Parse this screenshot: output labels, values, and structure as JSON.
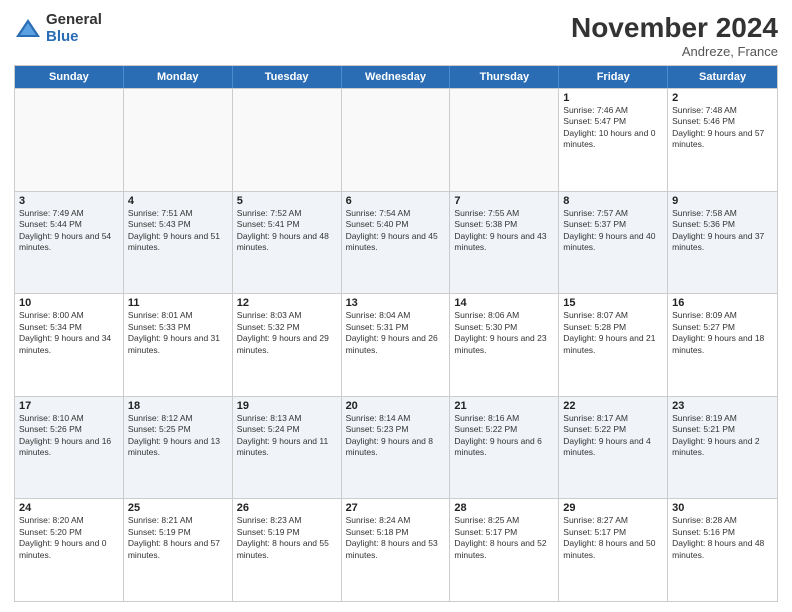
{
  "logo": {
    "general": "General",
    "blue": "Blue"
  },
  "title": "November 2024",
  "subtitle": "Andreze, France",
  "days": [
    "Sunday",
    "Monday",
    "Tuesday",
    "Wednesday",
    "Thursday",
    "Friday",
    "Saturday"
  ],
  "weeks": [
    [
      {
        "day": "",
        "info": ""
      },
      {
        "day": "",
        "info": ""
      },
      {
        "day": "",
        "info": ""
      },
      {
        "day": "",
        "info": ""
      },
      {
        "day": "",
        "info": ""
      },
      {
        "day": "1",
        "info": "Sunrise: 7:46 AM\nSunset: 5:47 PM\nDaylight: 10 hours and 0 minutes."
      },
      {
        "day": "2",
        "info": "Sunrise: 7:48 AM\nSunset: 5:46 PM\nDaylight: 9 hours and 57 minutes."
      }
    ],
    [
      {
        "day": "3",
        "info": "Sunrise: 7:49 AM\nSunset: 5:44 PM\nDaylight: 9 hours and 54 minutes."
      },
      {
        "day": "4",
        "info": "Sunrise: 7:51 AM\nSunset: 5:43 PM\nDaylight: 9 hours and 51 minutes."
      },
      {
        "day": "5",
        "info": "Sunrise: 7:52 AM\nSunset: 5:41 PM\nDaylight: 9 hours and 48 minutes."
      },
      {
        "day": "6",
        "info": "Sunrise: 7:54 AM\nSunset: 5:40 PM\nDaylight: 9 hours and 45 minutes."
      },
      {
        "day": "7",
        "info": "Sunrise: 7:55 AM\nSunset: 5:38 PM\nDaylight: 9 hours and 43 minutes."
      },
      {
        "day": "8",
        "info": "Sunrise: 7:57 AM\nSunset: 5:37 PM\nDaylight: 9 hours and 40 minutes."
      },
      {
        "day": "9",
        "info": "Sunrise: 7:58 AM\nSunset: 5:36 PM\nDaylight: 9 hours and 37 minutes."
      }
    ],
    [
      {
        "day": "10",
        "info": "Sunrise: 8:00 AM\nSunset: 5:34 PM\nDaylight: 9 hours and 34 minutes."
      },
      {
        "day": "11",
        "info": "Sunrise: 8:01 AM\nSunset: 5:33 PM\nDaylight: 9 hours and 31 minutes."
      },
      {
        "day": "12",
        "info": "Sunrise: 8:03 AM\nSunset: 5:32 PM\nDaylight: 9 hours and 29 minutes."
      },
      {
        "day": "13",
        "info": "Sunrise: 8:04 AM\nSunset: 5:31 PM\nDaylight: 9 hours and 26 minutes."
      },
      {
        "day": "14",
        "info": "Sunrise: 8:06 AM\nSunset: 5:30 PM\nDaylight: 9 hours and 23 minutes."
      },
      {
        "day": "15",
        "info": "Sunrise: 8:07 AM\nSunset: 5:28 PM\nDaylight: 9 hours and 21 minutes."
      },
      {
        "day": "16",
        "info": "Sunrise: 8:09 AM\nSunset: 5:27 PM\nDaylight: 9 hours and 18 minutes."
      }
    ],
    [
      {
        "day": "17",
        "info": "Sunrise: 8:10 AM\nSunset: 5:26 PM\nDaylight: 9 hours and 16 minutes."
      },
      {
        "day": "18",
        "info": "Sunrise: 8:12 AM\nSunset: 5:25 PM\nDaylight: 9 hours and 13 minutes."
      },
      {
        "day": "19",
        "info": "Sunrise: 8:13 AM\nSunset: 5:24 PM\nDaylight: 9 hours and 11 minutes."
      },
      {
        "day": "20",
        "info": "Sunrise: 8:14 AM\nSunset: 5:23 PM\nDaylight: 9 hours and 8 minutes."
      },
      {
        "day": "21",
        "info": "Sunrise: 8:16 AM\nSunset: 5:22 PM\nDaylight: 9 hours and 6 minutes."
      },
      {
        "day": "22",
        "info": "Sunrise: 8:17 AM\nSunset: 5:22 PM\nDaylight: 9 hours and 4 minutes."
      },
      {
        "day": "23",
        "info": "Sunrise: 8:19 AM\nSunset: 5:21 PM\nDaylight: 9 hours and 2 minutes."
      }
    ],
    [
      {
        "day": "24",
        "info": "Sunrise: 8:20 AM\nSunset: 5:20 PM\nDaylight: 9 hours and 0 minutes."
      },
      {
        "day": "25",
        "info": "Sunrise: 8:21 AM\nSunset: 5:19 PM\nDaylight: 8 hours and 57 minutes."
      },
      {
        "day": "26",
        "info": "Sunrise: 8:23 AM\nSunset: 5:19 PM\nDaylight: 8 hours and 55 minutes."
      },
      {
        "day": "27",
        "info": "Sunrise: 8:24 AM\nSunset: 5:18 PM\nDaylight: 8 hours and 53 minutes."
      },
      {
        "day": "28",
        "info": "Sunrise: 8:25 AM\nSunset: 5:17 PM\nDaylight: 8 hours and 52 minutes."
      },
      {
        "day": "29",
        "info": "Sunrise: 8:27 AM\nSunset: 5:17 PM\nDaylight: 8 hours and 50 minutes."
      },
      {
        "day": "30",
        "info": "Sunrise: 8:28 AM\nSunset: 5:16 PM\nDaylight: 8 hours and 48 minutes."
      }
    ]
  ]
}
